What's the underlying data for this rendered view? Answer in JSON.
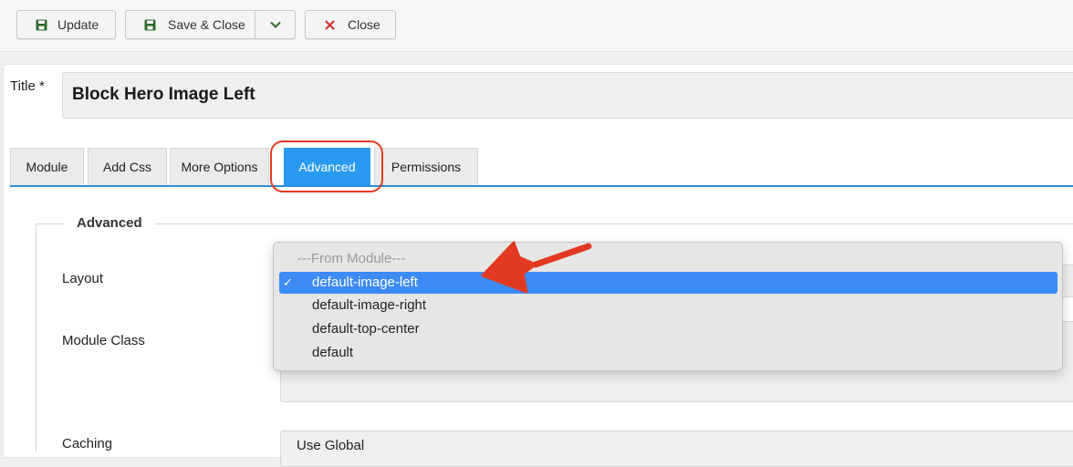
{
  "toolbar": {
    "update_label": "Update",
    "save_close_label": "Save & Close",
    "close_label": "Close",
    "icons": {
      "update": "save-icon",
      "save_close": "save-icon",
      "dropdown": "chevron-down-icon",
      "close": "close-x-icon"
    },
    "colors": {
      "save_icon": "#2e6b2e",
      "chevron": "#2e6b2e",
      "close_icon": "#d0312d"
    }
  },
  "form": {
    "title_label": "Title *",
    "title_value": "Block Hero Image Left"
  },
  "tabs": [
    {
      "label": "Module"
    },
    {
      "label": "Add Css"
    },
    {
      "label": "More Options"
    },
    {
      "label": "Advanced",
      "active": true
    },
    {
      "label": "Permissions"
    }
  ],
  "advanced": {
    "legend": "Advanced",
    "layout_label": "Layout",
    "module_class_label": "Module Class",
    "caching_label": "Caching",
    "caching_value": "Use Global",
    "layout_options": {
      "placeholder": "---From Module---",
      "selected": "default-image-left",
      "items": [
        "default-image-right",
        "default-top-center",
        "default"
      ]
    }
  },
  "annotation": {
    "color": "#e23a22"
  },
  "accent_color": "#2a9af0"
}
